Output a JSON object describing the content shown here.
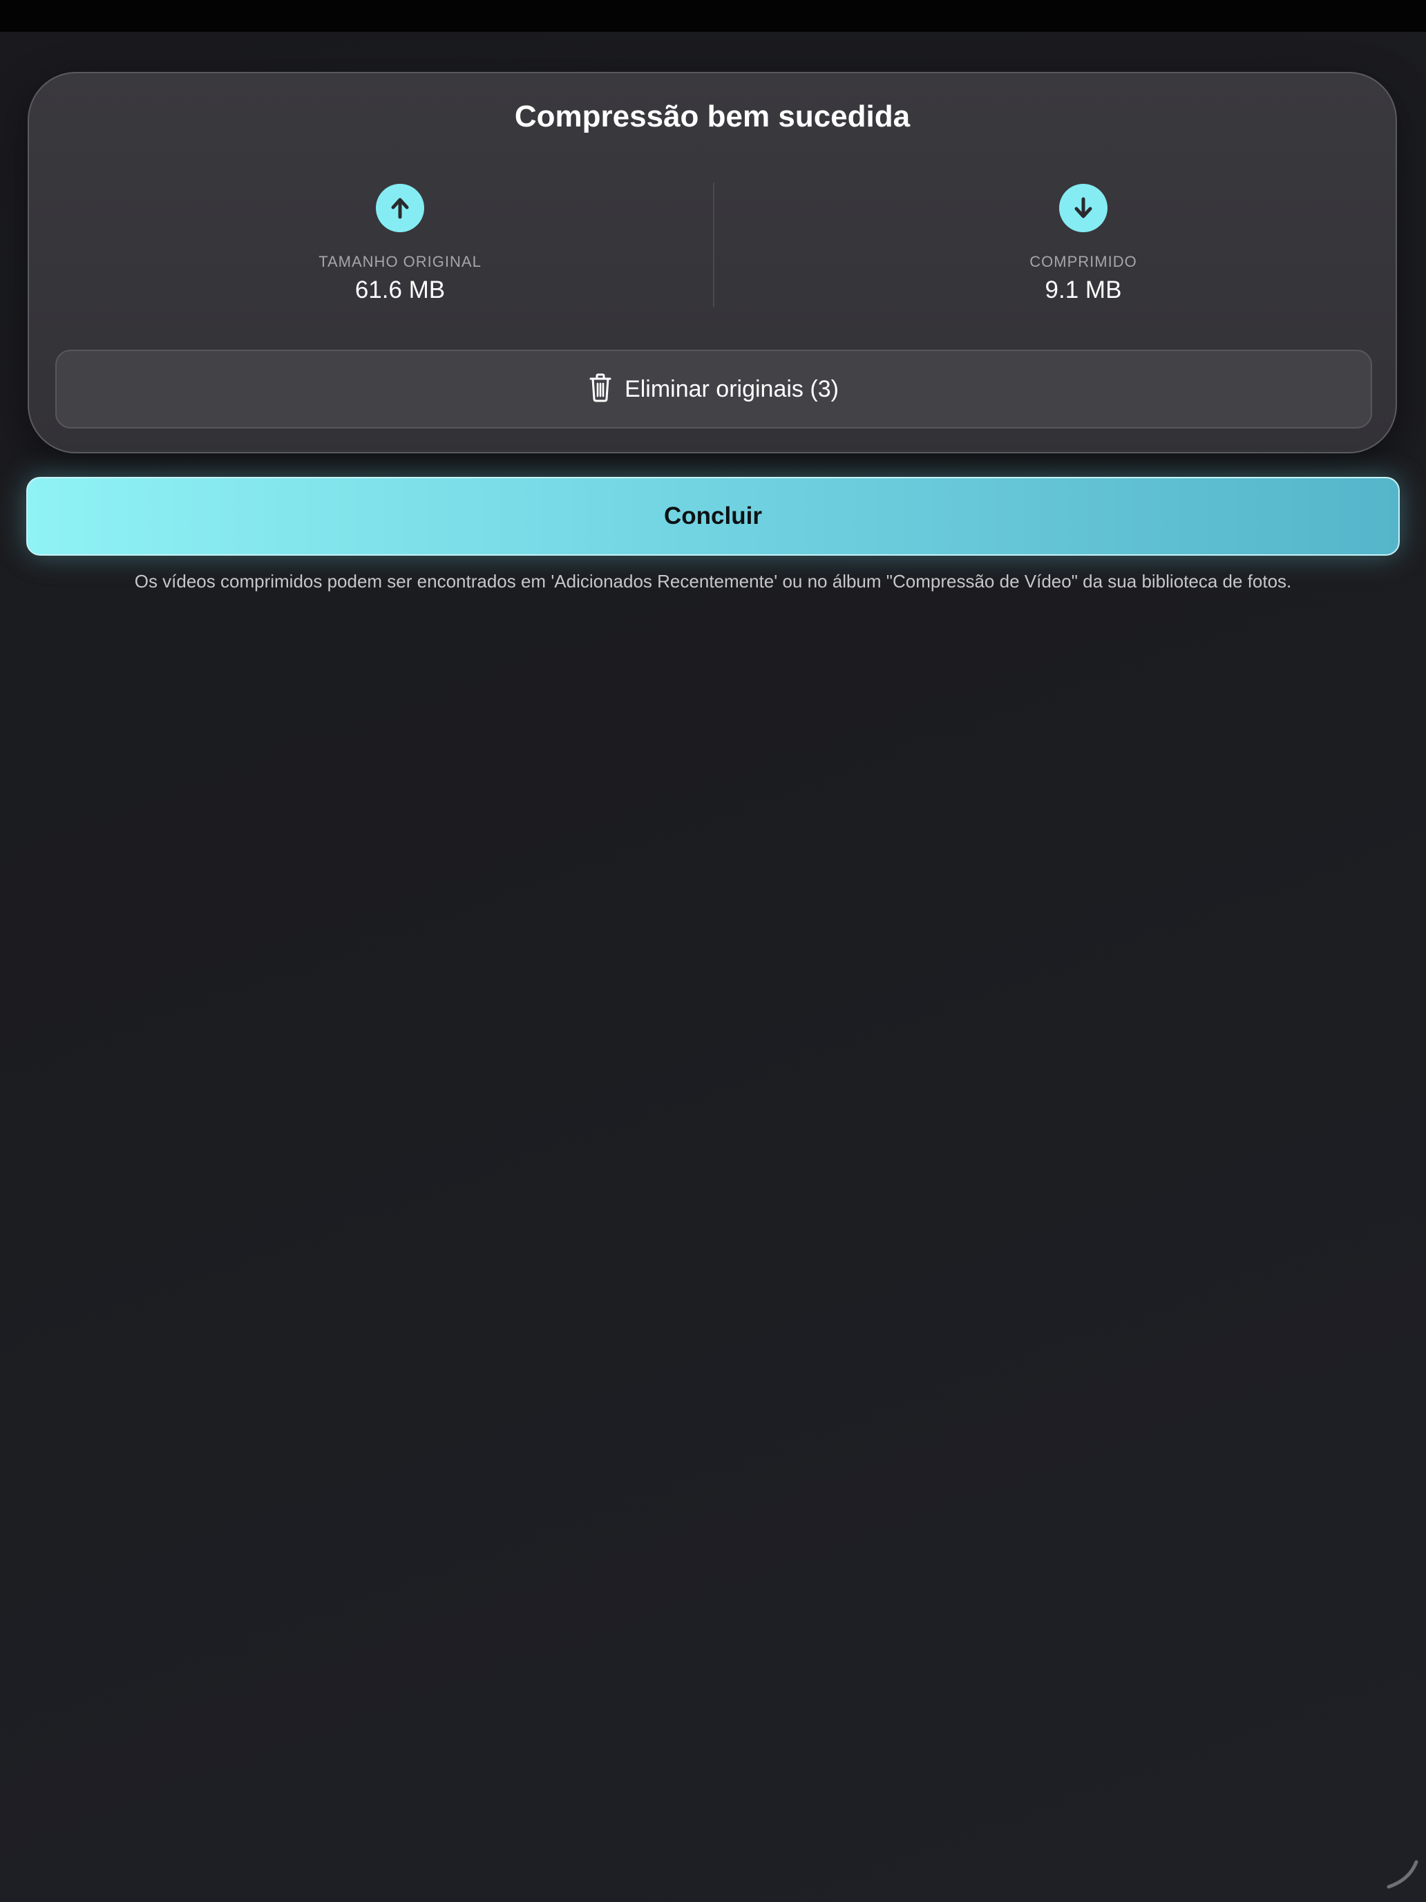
{
  "card": {
    "title": "Compressão bem sucedida",
    "original": {
      "icon": "arrow-up-icon",
      "label": "TAMANHO ORIGINAL",
      "value": "61.6 MB"
    },
    "compressed": {
      "icon": "arrow-down-icon",
      "label": "COMPRIMIDO",
      "value": "9.1 MB"
    },
    "delete_button": {
      "icon": "trash-icon",
      "label": "Eliminar originais (3)"
    }
  },
  "done_button": {
    "label": "Concluir"
  },
  "footnote": "Os vídeos comprimidos podem ser encontrados em 'Adicionados Recentemente' ou no álbum \"Compressão de Vídeo\" da sua biblioteca de fotos.",
  "colors": {
    "accent": "#85ecf3",
    "background": "#1c1d21",
    "card": "#37363b",
    "done_gradient_start": "#8ff2f4",
    "done_gradient_end": "#55b5ca"
  }
}
